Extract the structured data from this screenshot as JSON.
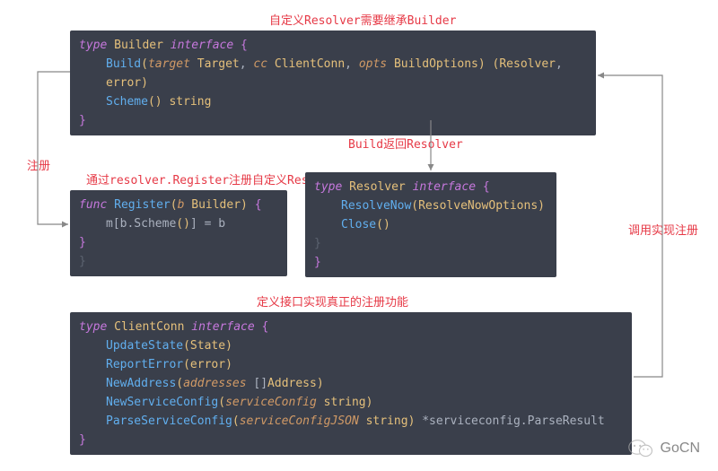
{
  "annotations": {
    "top": "自定义Resolver需要继承Builder",
    "leftRegister": "注册",
    "registerDesc": "通过resolver.Register注册自定义Resolver",
    "buildReturn": "Build返回Resolver",
    "rightCall": "调用实现注册",
    "defineInterface": "定义接口实现真正的注册功能"
  },
  "code": {
    "builder": {
      "l1_kw": "type",
      "l1_name": "Builder",
      "l1_iface": "interface",
      "l2_fn": "Build",
      "l2_p1": "target",
      "l2_t1": "Target",
      "l2_p2": "cc",
      "l2_t2": "ClientConn",
      "l2_p3": "opts",
      "l2_t3": "BuildOptions",
      "l2_r1": "Resolver",
      "l2_r2": "error",
      "l3_fn": "Scheme",
      "l3_ret": "string"
    },
    "register": {
      "l1_kw": "func",
      "l1_name": "Register",
      "l1_p": "b",
      "l1_t": "Builder",
      "l2_expr_a": "m",
      "l2_expr_b": "b.Scheme",
      "l2_rhs": "b"
    },
    "resolver": {
      "l1_kw": "type",
      "l1_name": "Resolver",
      "l1_iface": "interface",
      "l2_fn": "ResolveNow",
      "l2_t": "ResolveNowOptions",
      "l3_fn": "Close"
    },
    "clientconn": {
      "l1_kw": "type",
      "l1_name": "ClientConn",
      "l1_iface": "interface",
      "l2_fn": "UpdateState",
      "l2_t": "State",
      "l3_fn": "ReportError",
      "l3_t": "error",
      "l4_fn": "NewAddress",
      "l4_p": "addresses",
      "l4_t": "[]Address",
      "l5_fn": "NewServiceConfig",
      "l5_p": "serviceConfig",
      "l5_t": "string",
      "l6_fn": "ParseServiceConfig",
      "l6_p": "serviceConfigJSON",
      "l6_t": "string",
      "l6_ret": "*serviceconfig.ParseResult"
    }
  },
  "watermark": {
    "label": "GoCN"
  },
  "colors": {
    "annotation": "#e63946",
    "codeBg": "#3a3f4b",
    "keyword": "#c678dd",
    "type": "#e5c07b",
    "func": "#61afef",
    "param": "#d19a66",
    "arrow": "#888888"
  }
}
